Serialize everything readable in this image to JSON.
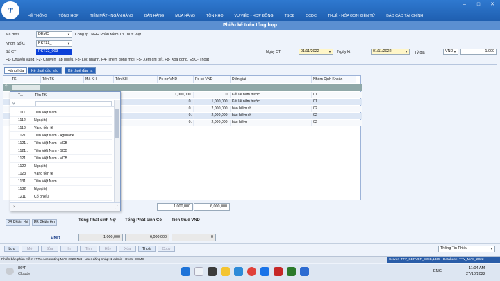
{
  "menu": [
    "HỆ THỐNG",
    "TỔNG HỢP",
    "TIỀN MẶT - NGÂN HÀNG",
    "BÁN HÀNG",
    "MUA HÀNG",
    "TỒN KHO",
    "VỤ VIỆC - HỢP ĐỒNG",
    "TSCĐ",
    "CCDC",
    "THUẾ - HÓA ĐƠN ĐIỆN TỬ",
    "BÁO CÁO TÀI CHÍNH"
  ],
  "window_title": "Phiếu kế toán tổng hợp",
  "form": {
    "ma_dvcs_label": "Mã đvcs",
    "ma_dvcs": "DEMO",
    "company": "Công ty TNHH Phần Mềm Trí Thức Việt",
    "nhom_so_ct_label": "Nhóm Số CT",
    "nhom_so_ct": "PKT22_",
    "so_ct_label": "Số CT",
    "so_ct": "PKT22_003",
    "ngay_ct_label": "Ngày CT",
    "ngay_ct": "01/11/2022",
    "ngay_kt_label": "Ngày kt",
    "ngay_kt": "01/11/2022",
    "ty_gia_label": "Tỷ giá",
    "currency": "VND",
    "ty_gia": "1.000",
    "hint": "F1- Chuyển vùng, F2- Chuyển Tab phiếu, F3- Lọc nhanh, F4- Thêm dòng mới, F5- Xem chi tiết, F8- Xóa dòng, ESC- Thoát"
  },
  "tabs": [
    "Hàng hóa",
    "Kê thuế đầu vào",
    "Kê thuế đầu ra"
  ],
  "grid": {
    "headers": [
      "TK",
      "Tên TK",
      "Mã KH",
      "Tên KH",
      "Ps nợ VND",
      "Ps có VND",
      "Diễn giải",
      "Nhóm Định Khoản"
    ],
    "rows": [
      {
        "no": "1,000,000.",
        "co": "0.",
        "dg": "Kết lãi năm trước",
        "nhom": "01"
      },
      {
        "no": "0.",
        "co": "1,000,000.",
        "dg": "Kết lãi năm trước",
        "nhom": "01"
      },
      {
        "no": "0.",
        "co": "2,000,000.",
        "dg": "bảo hiểm xh",
        "nhom": "02"
      },
      {
        "no": "0.",
        "co": "2,000,000.",
        "dg": "bảo hiểm xh",
        "nhom": "02"
      },
      {
        "no": "0.",
        "co": "2,000,000.",
        "dg": "bảo hiểm",
        "nhom": "02"
      }
    ],
    "sum_no": "1,000,000",
    "sum_co": "6,000,000"
  },
  "popup": {
    "headers": [
      "T...",
      "Tên TK"
    ],
    "items": [
      {
        "code": "1111",
        "name": "Tiền Việt Nam"
      },
      {
        "code": "1112",
        "name": "Ngoại tệ"
      },
      {
        "code": "1113",
        "name": "Vàng tiền tệ"
      },
      {
        "code": "1121...",
        "name": "Tiền Việt Nam - Agribank"
      },
      {
        "code": "1121...",
        "name": "Tiền Việt Nam - VCB"
      },
      {
        "code": "1121...",
        "name": "Tiền Việt Nam - SCB"
      },
      {
        "code": "1121...",
        "name": "Tiền Việt Nam - VCB"
      },
      {
        "code": "1122",
        "name": "Ngoại tệ"
      },
      {
        "code": "1123",
        "name": "Vàng tiền tệ"
      },
      {
        "code": "1131",
        "name": "Tiền Việt Nam"
      },
      {
        "code": "1132",
        "name": "Ngoại tệ"
      },
      {
        "code": "1211",
        "name": "Cổ phiếu"
      }
    ]
  },
  "summary": {
    "lbl_no": "Tổng Phát sinh  Nợ",
    "lbl_co": "Tổng Phát sinh Có",
    "lbl_thue": "Tiền thuế VND",
    "vnd": "VND",
    "no": "1,000,000",
    "co": "6,000,000",
    "thue": "0"
  },
  "print_buttons": [
    "PB Phiếu chi",
    "PB Phiếu thu"
  ],
  "buttons": [
    "Lưu",
    "Mới",
    "Sửa",
    "In",
    "Tìm",
    "Hủy",
    "Xóa",
    "Thoát",
    "Copy"
  ],
  "info_select": "Thông Tin Phiếu",
  "status_left": "Phiên bản phần mềm : TTV Accounting MAS 2020.Net - User đăng nhập: 1-admin . Đvcs: DEMO",
  "status_right": "Server: TTV_SERVER_WEB,1435 - Database: TTV_MAS_2022",
  "weather": {
    "temp": "86°F",
    "desc": "Cloudy"
  },
  "clock": {
    "time": "11:04 AM",
    "date": "27/10/2022"
  },
  "lang": "ENG"
}
